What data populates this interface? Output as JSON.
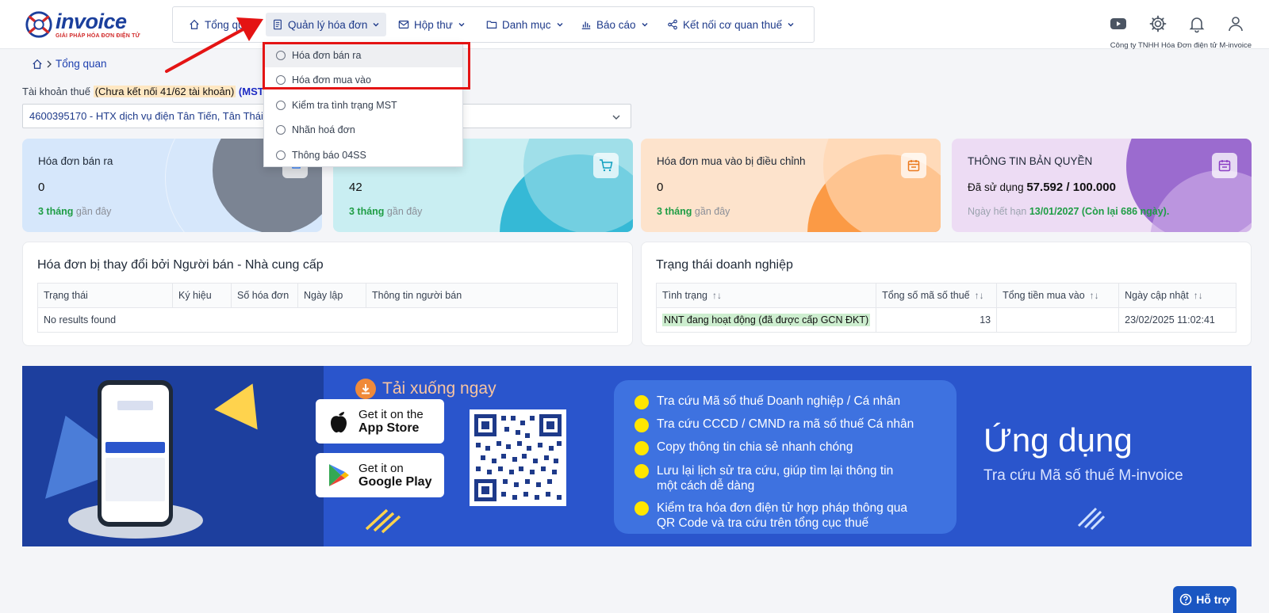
{
  "brand": {
    "logo_text": "invoice",
    "logo_sub": "GIẢI PHÁP HÓA ĐƠN ĐIỆN TỬ"
  },
  "nav": {
    "items": [
      {
        "label": "Tổng quan"
      },
      {
        "label": "Quản lý hóa đơn"
      },
      {
        "label": "Hộp thư"
      },
      {
        "label": "Danh mục"
      },
      {
        "label": "Báo cáo"
      },
      {
        "label": "Kết nối cơ quan thuế"
      }
    ]
  },
  "header": {
    "company": "Công ty TNHH Hóa Đơn điện tử M-invoice",
    "icons": [
      "youtube-icon",
      "gear-icon",
      "bell-icon",
      "user-icon"
    ]
  },
  "dropdown": {
    "items": [
      {
        "label": "Hóa đơn bán ra"
      },
      {
        "label": "Hóa đơn mua vào"
      },
      {
        "label": "Kiểm tra tình trạng MST"
      },
      {
        "label": "Nhãn hoá đơn"
      },
      {
        "label": "Thông báo 04SS"
      }
    ]
  },
  "breadcrumb": {
    "label": "Tổng quan"
  },
  "tax": {
    "label": "Tài khoản thuế",
    "status": "(Chưa kết nối 41/62 tài khoản)",
    "mst": "(MST đ",
    "selected": "4600395170 - HTX dịch vụ điện Tân Tiến, Tân Thái"
  },
  "cards": [
    {
      "title": "Hóa đơn bán ra",
      "value": "0",
      "sub_bold": "3 tháng",
      "sub_rest": " gần đây"
    },
    {
      "title": "",
      "value": "42",
      "sub_bold": "3 tháng",
      "sub_rest": " gần đây"
    },
    {
      "title": "Hóa đơn mua vào bị điều chỉnh",
      "value": "0",
      "sub_bold": "3 tháng",
      "sub_rest": " gần đây"
    },
    {
      "title": "THÔNG TIN BẢN QUYỀN",
      "value_prefix": "Đã sử dụng ",
      "value": "57.592 / 100.000",
      "sub_rest": "Ngày hết hạn ",
      "sub_bold": "13/01/2027 (Còn lại 686 ngày)."
    }
  ],
  "panel_changes": {
    "title": "Hóa đơn bị thay đổi bởi Người bán - Nhà cung cấp",
    "columns": [
      "Trạng thái",
      "Ký hiệu",
      "Số hóa đơn",
      "Ngày lập",
      "Thông tin người bán"
    ],
    "empty": "No results found"
  },
  "panel_status": {
    "title": "Trạng thái doanh nghiệp",
    "columns": [
      "Tình trạng",
      "Tổng số mã số thuế",
      "Tổng tiền mua vào",
      "Ngày cập nhật"
    ],
    "sort_icon": "↑↓",
    "rows": [
      {
        "status": "NNT đang hoạt động (đã được cấp GCN ĐKT)",
        "count": "13",
        "amount": "",
        "updated": "23/02/2025 11:02:41"
      }
    ]
  },
  "banner": {
    "download": "Tải xuống ngay",
    "appstore_t1": "Get it on the",
    "appstore_t2": "App Store",
    "gplay_t1": "Get it on",
    "gplay_t2": "Google Play",
    "features": [
      "Tra cứu Mã số thuế Doanh nghiệp / Cá nhân",
      "Tra cứu CCCD / CMND ra mã số thuế Cá nhân",
      "Copy thông tin chia sẻ nhanh chóng",
      "Lưu lại lịch sử tra cứu, giúp tìm lại thông tin|một cách dễ dàng",
      "Kiểm tra hóa đơn điện tử hợp pháp thông qua|QR Code và tra cứu trên tổng cục thuế"
    ],
    "app_title": "Ứng dụng",
    "app_sub": "Tra cứu Mã số thuế M-invoice"
  },
  "support": {
    "label": "Hỗ trợ"
  },
  "colors": {
    "primary": "#1e3a8a",
    "accent_red": "#e41414",
    "banner": "#2a55cc"
  }
}
